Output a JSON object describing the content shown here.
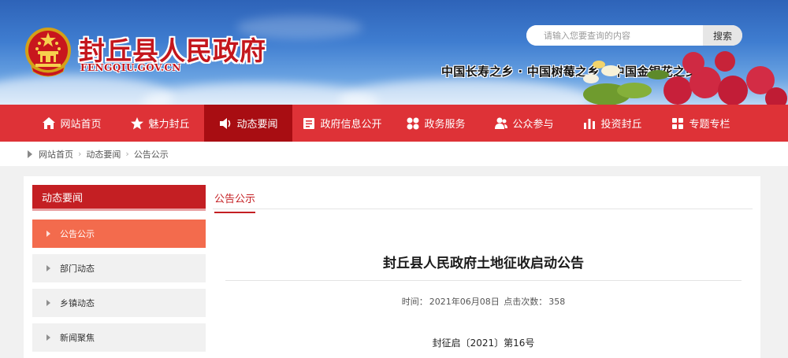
{
  "header": {
    "site_title": "封丘县人民政府",
    "site_domain": "FENGQIU.GOV.CN",
    "search_placeholder": "请输入您要查询的内容",
    "search_button": "搜索",
    "slogan": "中国长寿之乡 · 中国树莓之乡 · 中国金银花之乡"
  },
  "nav": {
    "items": [
      {
        "label": "网站首页",
        "icon": "home-icon"
      },
      {
        "label": "魅力封丘",
        "icon": "star-icon"
      },
      {
        "label": "动态要闻",
        "icon": "speaker-icon",
        "active": true
      },
      {
        "label": "政府信息公开",
        "icon": "document-icon"
      },
      {
        "label": "政务服务",
        "icon": "grid-icon"
      },
      {
        "label": "公众参与",
        "icon": "people-icon"
      },
      {
        "label": "投资封丘",
        "icon": "bar-chart-icon"
      },
      {
        "label": "专题专栏",
        "icon": "tiles-icon"
      }
    ]
  },
  "breadcrumb": [
    "网站首页",
    "动态要闻",
    "公告公示"
  ],
  "sidebar": {
    "heading": "动态要闻",
    "items": [
      {
        "label": "公告公示",
        "active": true
      },
      {
        "label": "部门动态"
      },
      {
        "label": "乡镇动态"
      },
      {
        "label": "新闻聚焦"
      }
    ]
  },
  "content": {
    "tab": "公告公示",
    "title": "封丘县人民政府土地征收启动公告",
    "meta_time_label": "时间：",
    "meta_time": "2021年06月08日",
    "meta_clicks_label": "点击次数：",
    "meta_clicks": "358",
    "doc_no": "封征启〔2021〕第16号"
  },
  "colors": {
    "nav_red": "#de3237",
    "nav_active": "#a80d12",
    "side_active": "#f36b4d",
    "title_red": "#c4161c"
  }
}
